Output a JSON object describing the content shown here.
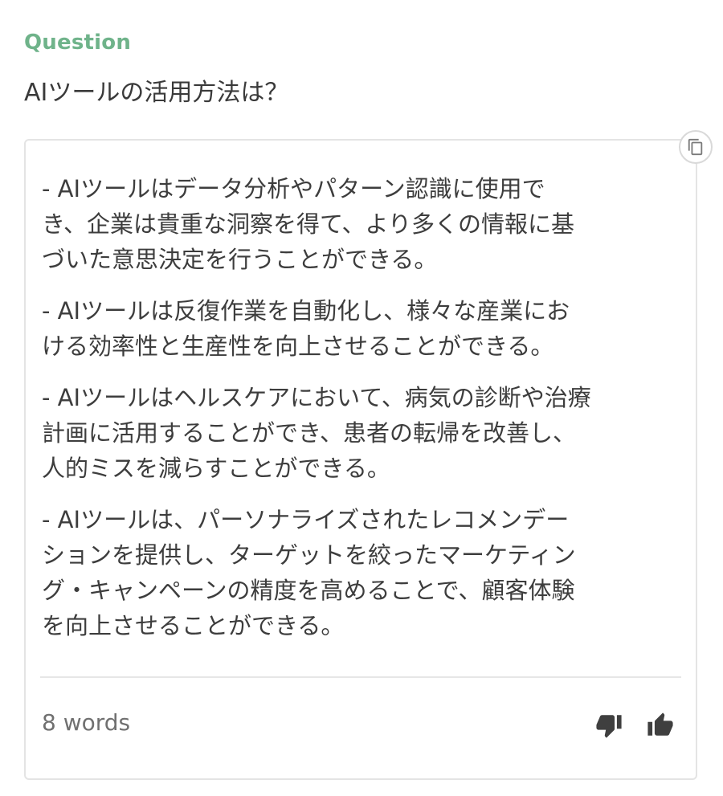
{
  "question": {
    "label": "Question",
    "text": "AIツールの活用方法は？"
  },
  "answer": {
    "items": [
      "- AIツールはデータ分析やパターン認識に使用で\nき、企業は貴重な洞察を得て、より多くの情報に基\nづいた意思決定を行うことができる。",
      "- AIツールは反復作業を自動化し、様々な産業にお\nける効率性と生産性を向上させることができる。",
      "- AIツールはヘルスケアにおいて、病気の診断や治療\n計画に活用することができ、患者の転帰を改善し、\n人的ミスを減らすことができる。",
      "- AIツールは、パーソナライズされたレコメンデー\nションを提供し、ターゲットを絞ったマーケティン\nグ・キャンペーンの精度を高めることで、顧客体験\nを向上させることができる。"
    ],
    "word_count": "8 words"
  },
  "icons": {
    "copy": "copy-icon",
    "thumbs_down": "thumbs-down-icon",
    "thumbs_up": "thumbs-up-icon"
  },
  "colors": {
    "accent": "#6fb38a",
    "text": "#3d3d3d",
    "muted": "#707070",
    "border": "#e4e4e4"
  }
}
